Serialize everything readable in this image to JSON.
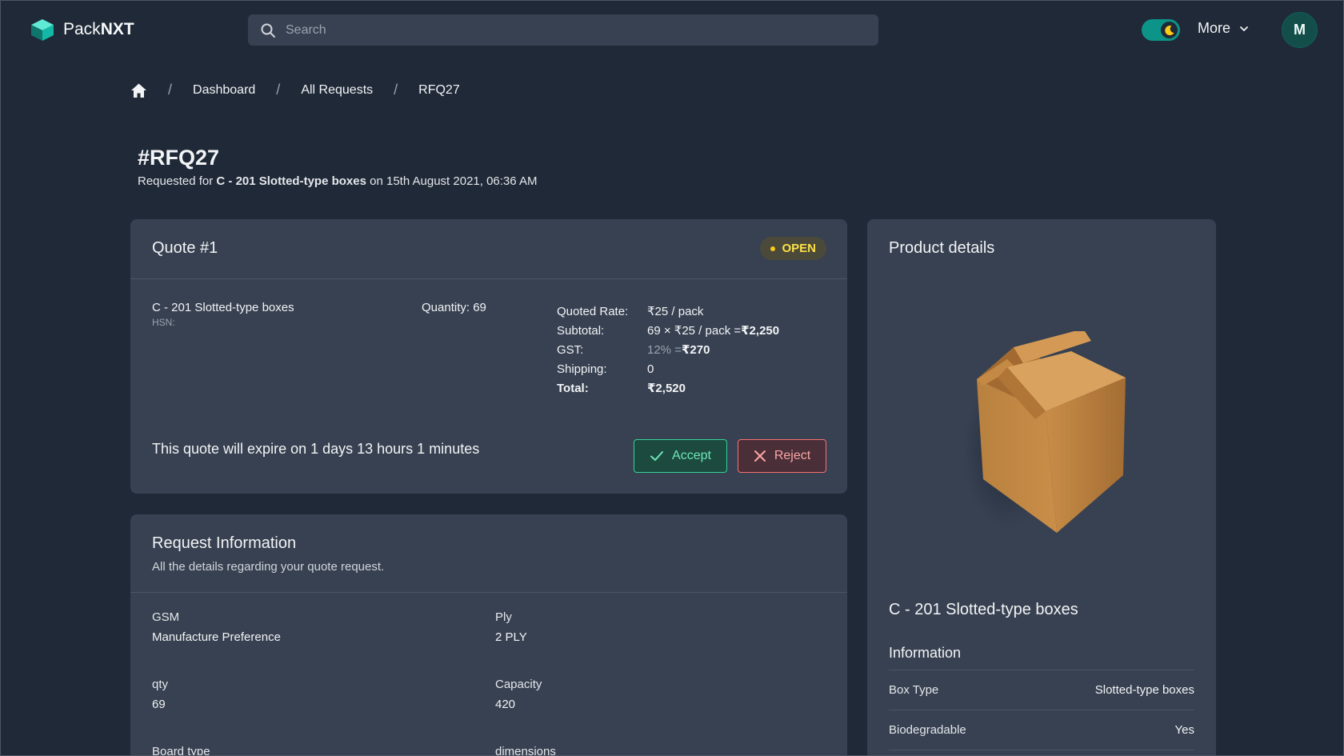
{
  "app": {
    "logo_prefix": "Pack",
    "logo_suffix": "NXT",
    "search_placeholder": "Search",
    "more_label": "More",
    "avatar_initial": "M",
    "accent_color": "#0d9488"
  },
  "breadcrumb": {
    "items": [
      "Dashboard",
      "All Requests",
      "RFQ27"
    ],
    "separator": "/"
  },
  "request": {
    "title": "#RFQ27",
    "subtitle_prefix": "Requested for",
    "product": "C - 201 Slotted-type boxes",
    "subtitle_suffix": "on 15th August 2021, 06:36 AM"
  },
  "quote": {
    "title": "Quote #1",
    "status": "OPEN",
    "item_name": "C - 201 Slotted-type boxes",
    "hsn_label": "HSN:",
    "quantity": "Quantity: 69",
    "rates": {
      "quoted_rate_label": "Quoted Rate:",
      "quoted_rate_value": "₹25 / pack",
      "subtotal_label": "Subtotal:",
      "subtotal_formula": "69 × ₹25 / pack = ",
      "subtotal_value": "₹2,250",
      "gst_label": "GST:",
      "gst_percent": "12% = ",
      "gst_value": "₹270",
      "shipping_label": "Shipping:",
      "shipping_value": "0",
      "total_label": "Total:",
      "total_value": "₹2,520"
    },
    "expiry_text": "This quote will expire on 1 days 13 hours 1 minutes",
    "accept_label": "Accept",
    "reject_label": "Reject"
  },
  "request_info": {
    "title": "Request Information",
    "description": "All the details regarding your quote request.",
    "fields": [
      {
        "label": "GSM",
        "value": "Manufacture Preference"
      },
      {
        "label": "Ply",
        "value": "2 PLY"
      },
      {
        "label": "qty",
        "value": "69"
      },
      {
        "label": "Capacity",
        "value": "420"
      },
      {
        "label": "Board type",
        "value": ""
      },
      {
        "label": "dimensions",
        "value": ""
      }
    ]
  },
  "product": {
    "title": "Product details",
    "name": "C - 201 Slotted-type boxes",
    "info_heading": "Information",
    "info": [
      {
        "key": "Box Type",
        "value": "Slotted-type boxes"
      },
      {
        "key": "Biodegradable",
        "value": "Yes"
      }
    ]
  }
}
